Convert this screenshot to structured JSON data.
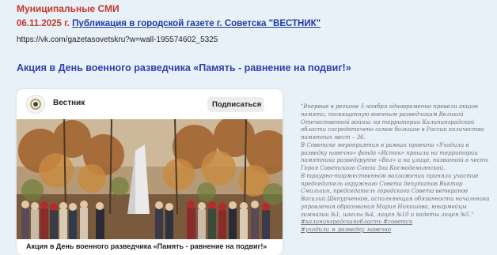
{
  "header": {
    "section": "Муниципальные СМИ",
    "date": "06.11.2025 г.",
    "publication_link": "Публикация в городской газете г. Советска \"ВЕСТНИК\"",
    "url": "https://vk.com/gazetasovetskru?w=wall-195574602_5325"
  },
  "article": {
    "headline": "Акция в День военного разведчика «Память - равнение на подвиг!»"
  },
  "post_card": {
    "channel_name": "Вестник",
    "subscribe_label": "Подписаться",
    "caption": "Акция в День военного разведчика «Память - равнение на подвиг!»"
  },
  "quote": {
    "paragraphs": [
      "\"Впервые в регионе 5 ноября одновременно провели акцию памяти, посвященную военным разведчикам Великой Отечественной войны: на территории Калининградской области сосредоточено самое большое в России количество памятных мест – 36.",
      "В Советске мероприятия в рамках проекта «Уходили в разведку навечно» фонда «Исток» прошли на территории памятника разведгруппе «Вол» и на улице, названной в честь Героя Советского Союза Зои Космодемьянской.",
      "В траурно-торжественном возложении приняли участие председатель окружного Совета депутатов Виктор Смильгин, председатель городского Совета ветеранов Василий Шепурченков, исполняющая обязанности начальника управления образования Мария Никишова, юнармейцы гимназии №1, школы №4, лицея №10 и кадеты лицея №5.\""
    ],
    "hashtags_line1": "#калининградскаяобласть #советск",
    "hashtags_line2": "#уходили_в_разведку_навечно"
  },
  "colors": {
    "accent_red": "#c0392b",
    "link_blue": "#1a3aa6",
    "headline_blue": "#2c3fb0",
    "page_bg": "#e9f1f8"
  }
}
